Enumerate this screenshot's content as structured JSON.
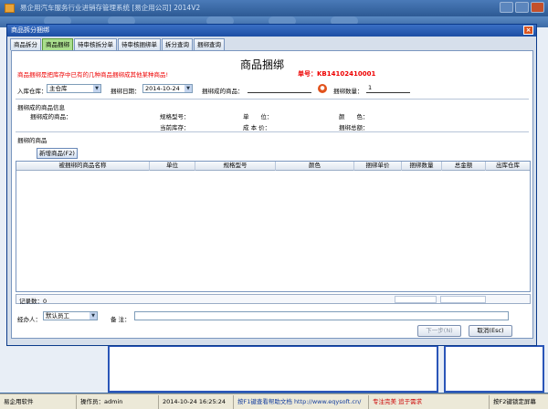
{
  "app": {
    "title": "易企用汽车服务行业进销存管理系统 [易企用公司] 2014V2"
  },
  "statusbar": {
    "software": "易企用软件",
    "operator": "操作员：admin",
    "datetime": "2014-10-24 16:25:24",
    "help": "按F1键查看帮助文档 http://www.eqysoft.cn/",
    "slogan": "专注完美 追于需求",
    "lock": "按F2键锁定屏幕"
  },
  "dialog": {
    "title": "商品拆分捆绑",
    "close_icon": "close-icon",
    "tabs": [
      {
        "label": "商品拆分",
        "active": false
      },
      {
        "label": "商品捆绑",
        "active": true
      },
      {
        "label": "待审核拆分单",
        "active": false
      },
      {
        "label": "待审核捆绑单",
        "active": false
      },
      {
        "label": "拆分查询",
        "active": false
      },
      {
        "label": "捆绑查询",
        "active": false
      }
    ]
  },
  "form": {
    "main_title": "商品捆绑",
    "warning": "商品捆绑是把库存中已有的几种商品捆绑成其他某种商品!",
    "order_no": "单号：KB14102410001",
    "warehouse_label": "入库仓库：",
    "warehouse_value": "主仓库",
    "date_label": "捆绑日期：",
    "date_value": "2014-10-24",
    "product_label": "捆绑成的商品：",
    "product_value": "",
    "qty_label": "捆绑数量：",
    "qty_value": "1",
    "section_info": "捆绑成的商品信息",
    "info_product": "捆绑成的商品：",
    "info_spec": "规格型号：",
    "info_unit": "单　　位：",
    "info_color": "颜　　色：",
    "info_stock": "当前库存：",
    "info_cost": "成 本 价：",
    "info_total": "捆绑总额：",
    "section_items": "捆绑的商品",
    "add_button": "新增商品(F2)",
    "record_count": "记录数：0",
    "handler_label": "经办人：",
    "handler_value": "默认员工",
    "remark_label": "备 注：",
    "remark_value": "",
    "next_button": "下一步(N)",
    "cancel_button": "取消(Esc)"
  },
  "grid": {
    "columns": [
      "被捆绑的商品名称",
      "单位",
      "规格型号",
      "颜色",
      "捆绑单价",
      "捆绑数量",
      "总金额",
      "出库仓库"
    ]
  }
}
